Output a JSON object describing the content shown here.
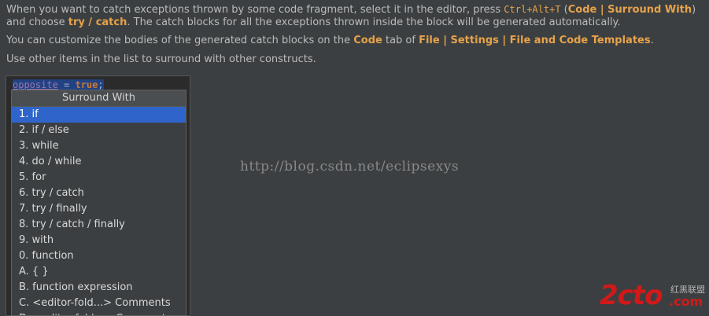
{
  "intro": {
    "line1_pre": "When you want to catch exceptions thrown by some code fragment, select it in the editor, press ",
    "shortcut": "Ctrl+Alt+T",
    "line1_mid": " (",
    "menu_path": "Code | Surround With",
    "line2_mid": ") and choose ",
    "choice": "try / catch",
    "line2_post": ". The catch blocks for all the exceptions thrown inside the block will be generated automatically."
  },
  "customize": {
    "pre": "You can customize the bodies of the generated catch blocks on the ",
    "tab": "Code",
    "mid": " tab of ",
    "settings_path": "File | Settings | File and Code Templates",
    "post": "."
  },
  "other_items": "Use other items in the list to surround with other constructs.",
  "code": {
    "variable": "opposite",
    "operator": " = ",
    "keyword": "true",
    "terminator": ";"
  },
  "popup": {
    "title": "Surround With",
    "items": [
      "1. if",
      "2. if / else",
      "3. while",
      "4. do / while",
      "5. for",
      "6. try / catch",
      "7. try / finally",
      "8. try / catch / finally",
      "9. with",
      "0. function",
      "A. { }",
      "B. function expression",
      "C. <editor-fold...> Comments",
      "D. <editor-fold...> Comments"
    ],
    "selected_index": 0
  },
  "watermark": "http://blog.csdn.net/eclipsexys",
  "logo": {
    "brand": "2cto",
    "cn": "红黑联盟",
    "com": ".com"
  },
  "colors": {
    "background": "#3c3f41",
    "highlight": "#e7a34b",
    "selection": "#2f65ca"
  }
}
